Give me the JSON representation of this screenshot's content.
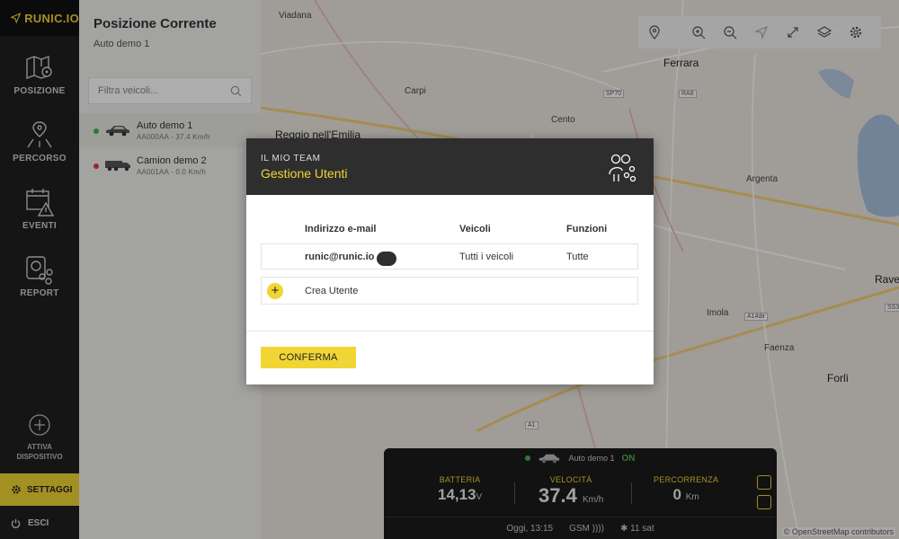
{
  "app": {
    "logo_text": "RUNIC.IO"
  },
  "sidebar": {
    "items": [
      {
        "label": "POSIZIONE"
      },
      {
        "label": "PERCORSO"
      },
      {
        "label": "EVENTI"
      },
      {
        "label": "REPORT"
      }
    ],
    "activate": {
      "line1": "ATTIVA",
      "line2": "DISPOSITIVO"
    },
    "settings_label": "SETTAGGI",
    "exit_label": "ESCI"
  },
  "panel": {
    "title": "Posizione Corrente",
    "subtitle": "Auto demo 1",
    "filter_placeholder": "Filtra veicoli...",
    "vehicles": [
      {
        "name": "Auto demo 1",
        "meta": "AA000AA - 37.4 Km/h",
        "status_color": "#4caf50",
        "icon": "car-icon"
      },
      {
        "name": "Camion demo 2",
        "meta": "AA001AA - 0.0 Km/h",
        "status_color": "#e53935",
        "icon": "truck-icon"
      }
    ]
  },
  "map": {
    "cities": {
      "viadana": "Viadana",
      "ferrara": "Ferrara",
      "carpi": "Carpi",
      "reggio": "Reggio nell'Emilia",
      "cento": "Cento",
      "argenta": "Argenta",
      "imola": "Imola",
      "faenza": "Faenza",
      "forli": "Forlì",
      "rave": "Rave"
    },
    "roads": {
      "sp70": "SP70",
      "ra8": "RA8",
      "a14dir": "A14dir",
      "a1": "A1",
      "ss": "SS3"
    },
    "attribution": "© OpenStreetMap contributors"
  },
  "modal": {
    "kicker": "IL MIO TEAM",
    "title": "Gestione Utenti",
    "columns": {
      "email": "Indirizzo e-mail",
      "vehicles": "Veicoli",
      "functions": "Funzioni"
    },
    "users": [
      {
        "email": "runic@runic.io",
        "badge": "Tu",
        "vehicles": "Tutti i veicoli",
        "functions": "Tutte"
      }
    ],
    "create_label": "Crea Utente",
    "confirm_label": "CONFERMA"
  },
  "dashboard": {
    "vehicle_name": "Auto demo 1",
    "status": "ON",
    "battery": {
      "label": "BATTERIA",
      "value": "14,13",
      "unit": "V"
    },
    "speed": {
      "label": "VELOCITÀ",
      "value": "37.4",
      "unit": "Km/h"
    },
    "distance": {
      "label": "PERCORRENZA",
      "value": "0",
      "unit": "Km"
    },
    "time": "Oggi, 13:15",
    "gsm": "GSM",
    "satellites": "11 sat"
  },
  "colors": {
    "accent": "#f1d534",
    "sidebar_bg": "#1f1f1f",
    "online": "#4caf50",
    "offline": "#e53935"
  }
}
